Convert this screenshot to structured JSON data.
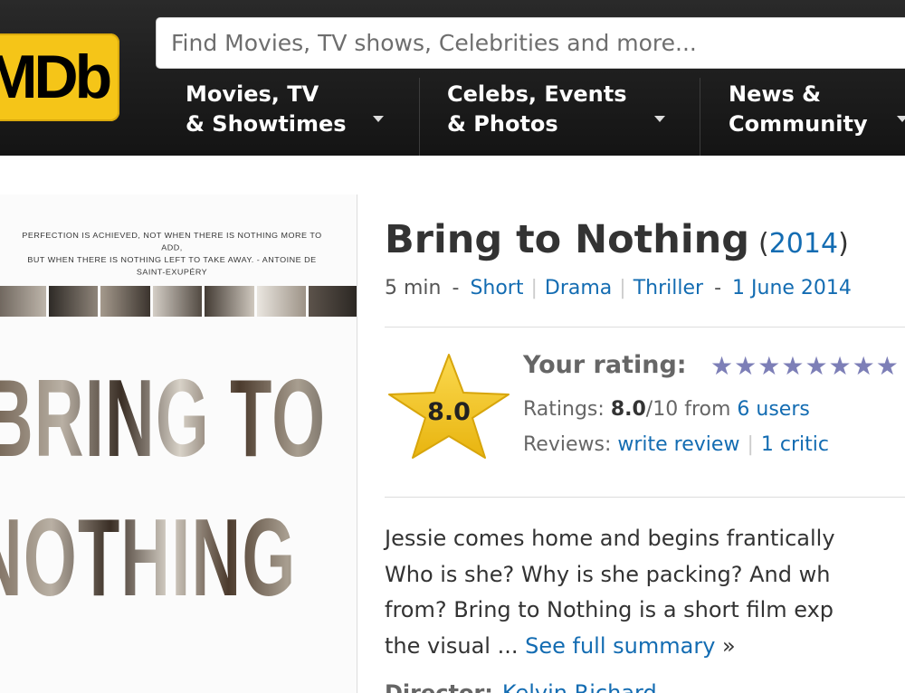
{
  "header": {
    "logo_text": "IMDb",
    "search_placeholder": "Find Movies, TV shows, Celebrities and more...",
    "nav": [
      {
        "line1": "Movies, TV",
        "line2": "& Showtimes"
      },
      {
        "line1": "Celebs, Events",
        "line2": "& Photos"
      },
      {
        "line1": "News &",
        "line2": "Community"
      }
    ]
  },
  "poster": {
    "tagline_line1": "PERFECTION IS ACHIEVED, NOT WHEN THERE IS NOTHING MORE TO ADD,",
    "tagline_line2": "BUT WHEN THERE IS NOTHING LEFT TO TAKE AWAY. - ANTOINE DE SAINT-EXUPÉRY",
    "title_line1": "BRING TO",
    "title_line2": "NOTHING"
  },
  "title": {
    "name": "Bring to Nothing",
    "year": "2014"
  },
  "meta": {
    "runtime": "5 min",
    "genres": [
      "Short",
      "Drama",
      "Thriller"
    ],
    "release_date": "1 June 2014"
  },
  "rating": {
    "star_value": "8.0",
    "your_rating_label": "Your rating:",
    "ratings_label": "Ratings:",
    "score": "8.0",
    "out_of": "/10 from",
    "users_link": "6 users",
    "reviews_label": "Reviews:",
    "write_review": "write review",
    "critic": "1 critic"
  },
  "summary": {
    "line1": "Jessie comes home and begins frantically",
    "line2": "Who is she? Why is she packing? And wh",
    "line3": "from? Bring to Nothing is a short film exp",
    "line4": "the visual ... ",
    "see_full": "See full summary",
    "arrow": "»"
  },
  "credits": {
    "director_label": "Director:",
    "director_name": "Kelvin Richard"
  },
  "colors": {
    "link": "#136cb2",
    "logo_yellow": "#f5c518",
    "star_yellow": "#f5c518",
    "rating_stars": "#7d7fb7"
  }
}
